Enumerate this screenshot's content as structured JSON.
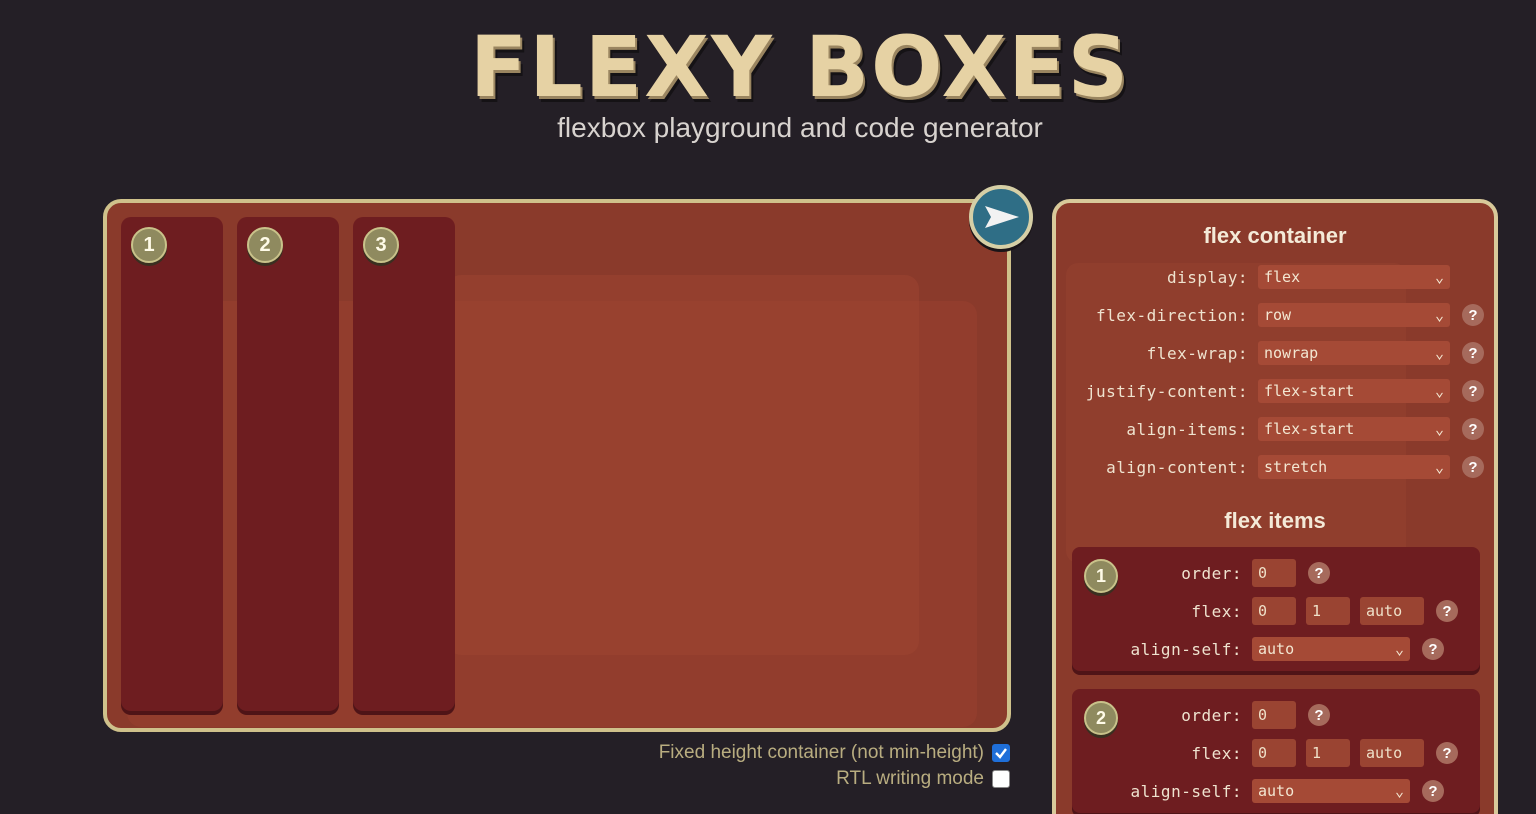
{
  "header": {
    "logo": "FLEXY BOXES",
    "subtitle": "flexbox playground and code generator"
  },
  "playground": {
    "items": [
      "1",
      "2",
      "3"
    ],
    "options": [
      {
        "label": "Fixed height container (not min-height)",
        "checked": true
      },
      {
        "label": "RTL writing mode",
        "checked": false
      }
    ]
  },
  "container": {
    "title": "flex container",
    "props": [
      {
        "name": "display:",
        "value": "flex",
        "help": false
      },
      {
        "name": "flex-direction:",
        "value": "row",
        "help": true
      },
      {
        "name": "flex-wrap:",
        "value": "nowrap",
        "help": true
      },
      {
        "name": "justify-content:",
        "value": "flex-start",
        "help": true
      },
      {
        "name": "align-items:",
        "value": "flex-start",
        "help": true
      },
      {
        "name": "align-content:",
        "value": "stretch",
        "help": true
      }
    ]
  },
  "flex_items": {
    "title": "flex items",
    "items": [
      {
        "number": "1",
        "order_label": "order:",
        "order": "0",
        "flex_label": "flex:",
        "grow": "0",
        "shrink": "1",
        "basis": "auto",
        "align_label": "align-self:",
        "align_self": "auto"
      },
      {
        "number": "2",
        "order_label": "order:",
        "order": "0",
        "flex_label": "flex:",
        "grow": "0",
        "shrink": "1",
        "basis": "auto",
        "align_label": "align-self:",
        "align_self": "auto"
      }
    ]
  },
  "help_glyph": "?",
  "colors": {
    "background": "#241f26",
    "panel": "#8a3a2b",
    "item": "#6e1d20",
    "border": "#cfc18b",
    "play": "#2f6e86"
  }
}
